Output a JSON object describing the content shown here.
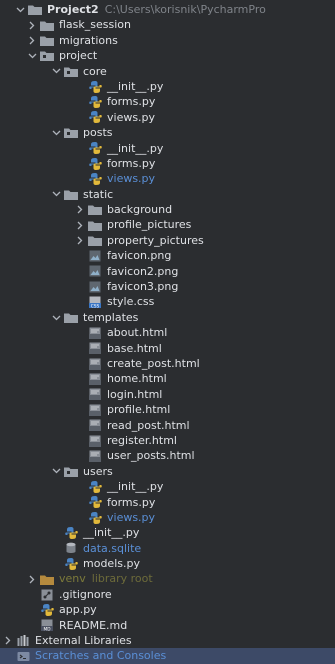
{
  "tree": {
    "root": {
      "label": "Project2",
      "path": "C:\\Users\\korisnik\\PycharmPro"
    },
    "rows": [
      {
        "id": "flask_session",
        "depth": 1,
        "chev": "right",
        "icon": "folder-icon",
        "label": "flask_session"
      },
      {
        "id": "migrations",
        "depth": 1,
        "chev": "right",
        "icon": "folder-icon",
        "label": "migrations"
      },
      {
        "id": "project",
        "depth": 1,
        "chev": "down",
        "icon": "package-folder-icon",
        "label": "project"
      },
      {
        "id": "core",
        "depth": 2,
        "chev": "down",
        "icon": "package-folder-icon",
        "label": "core"
      },
      {
        "id": "core_init",
        "depth": 3,
        "icon": "python-file-icon",
        "label": "__init__.py"
      },
      {
        "id": "core_forms",
        "depth": 3,
        "icon": "python-file-icon",
        "label": "forms.py"
      },
      {
        "id": "core_views",
        "depth": 3,
        "icon": "python-file-icon",
        "label": "views.py"
      },
      {
        "id": "posts",
        "depth": 2,
        "chev": "down",
        "icon": "package-folder-icon",
        "label": "posts"
      },
      {
        "id": "posts_init",
        "depth": 3,
        "icon": "python-file-icon",
        "label": "__init__.py"
      },
      {
        "id": "posts_forms",
        "depth": 3,
        "icon": "python-file-icon",
        "label": "forms.py"
      },
      {
        "id": "posts_views",
        "depth": 3,
        "icon": "python-file-icon",
        "label": "views.py",
        "style": "blue"
      },
      {
        "id": "static",
        "depth": 2,
        "chev": "down",
        "icon": "folder-icon",
        "label": "static"
      },
      {
        "id": "background",
        "depth": 3,
        "chev": "right",
        "icon": "folder-icon",
        "label": "background"
      },
      {
        "id": "profile_pictures",
        "depth": 3,
        "chev": "right",
        "icon": "folder-icon",
        "label": "profile_pictures"
      },
      {
        "id": "property_pictures",
        "depth": 3,
        "chev": "right",
        "icon": "folder-icon",
        "label": "property_pictures"
      },
      {
        "id": "favicon",
        "depth": 3,
        "icon": "image-file-icon",
        "label": "favicon.png"
      },
      {
        "id": "favicon2",
        "depth": 3,
        "icon": "image-file-icon",
        "label": "favicon2.png"
      },
      {
        "id": "favicon3",
        "depth": 3,
        "icon": "image-file-icon",
        "label": "favicon3.png"
      },
      {
        "id": "style_css",
        "depth": 3,
        "icon": "css-file-icon",
        "label": "style.css"
      },
      {
        "id": "templates",
        "depth": 2,
        "chev": "down",
        "icon": "folder-icon",
        "label": "templates"
      },
      {
        "id": "about_html",
        "depth": 3,
        "icon": "html-file-icon",
        "label": "about.html"
      },
      {
        "id": "base_html",
        "depth": 3,
        "icon": "html-file-icon",
        "label": "base.html"
      },
      {
        "id": "create_post_html",
        "depth": 3,
        "icon": "html-file-icon",
        "label": "create_post.html"
      },
      {
        "id": "home_html",
        "depth": 3,
        "icon": "html-file-icon",
        "label": "home.html"
      },
      {
        "id": "login_html",
        "depth": 3,
        "icon": "html-file-icon",
        "label": "login.html"
      },
      {
        "id": "profile_html",
        "depth": 3,
        "icon": "html-file-icon",
        "label": "profile.html"
      },
      {
        "id": "read_post_html",
        "depth": 3,
        "icon": "html-file-icon",
        "label": "read_post.html"
      },
      {
        "id": "register_html",
        "depth": 3,
        "icon": "html-file-icon",
        "label": "register.html"
      },
      {
        "id": "user_posts_html",
        "depth": 3,
        "icon": "html-file-icon",
        "label": "user_posts.html"
      },
      {
        "id": "users",
        "depth": 2,
        "chev": "down",
        "icon": "package-folder-icon",
        "label": "users"
      },
      {
        "id": "users_init",
        "depth": 3,
        "icon": "python-file-icon",
        "label": "__init__.py"
      },
      {
        "id": "users_forms",
        "depth": 3,
        "icon": "python-file-icon",
        "label": "forms.py"
      },
      {
        "id": "users_views",
        "depth": 3,
        "icon": "python-file-icon",
        "label": "views.py",
        "style": "blue"
      },
      {
        "id": "project_init",
        "depth": 2,
        "icon": "python-file-icon",
        "label": "__init__.py"
      },
      {
        "id": "data_sqlite",
        "depth": 2,
        "icon": "database-file-icon",
        "label": "data.sqlite",
        "style": "blue"
      },
      {
        "id": "models_py",
        "depth": 2,
        "icon": "python-file-icon",
        "label": "models.py"
      },
      {
        "id": "venv",
        "depth": 1,
        "chev": "right",
        "icon": "excluded-folder-icon",
        "label": "venv",
        "style": "olive",
        "suffix": "library root"
      },
      {
        "id": "gitignore",
        "depth": 1,
        "icon": "gitignore-file-icon",
        "label": ".gitignore"
      },
      {
        "id": "app_py",
        "depth": 1,
        "icon": "python-file-icon",
        "label": "app.py"
      },
      {
        "id": "readme",
        "depth": 1,
        "icon": "markdown-file-icon",
        "label": "README.md"
      },
      {
        "id": "external_libraries",
        "depth": 0,
        "chev": "right",
        "icon": "libraries-icon",
        "label": "External Libraries"
      },
      {
        "id": "scratches",
        "depth": 0,
        "icon": "scratches-icon",
        "label": "Scratches and Consoles",
        "style": "blue",
        "selected": true
      }
    ]
  },
  "colors": {
    "background": "#2b2d30",
    "selection": "#3d4a67",
    "folder": "#9aa0a8",
    "python_blue": "#4a84c4",
    "python_yellow": "#e2b93b",
    "link_blue": "#5a8fd6",
    "excluded": "#7c7a3a"
  }
}
